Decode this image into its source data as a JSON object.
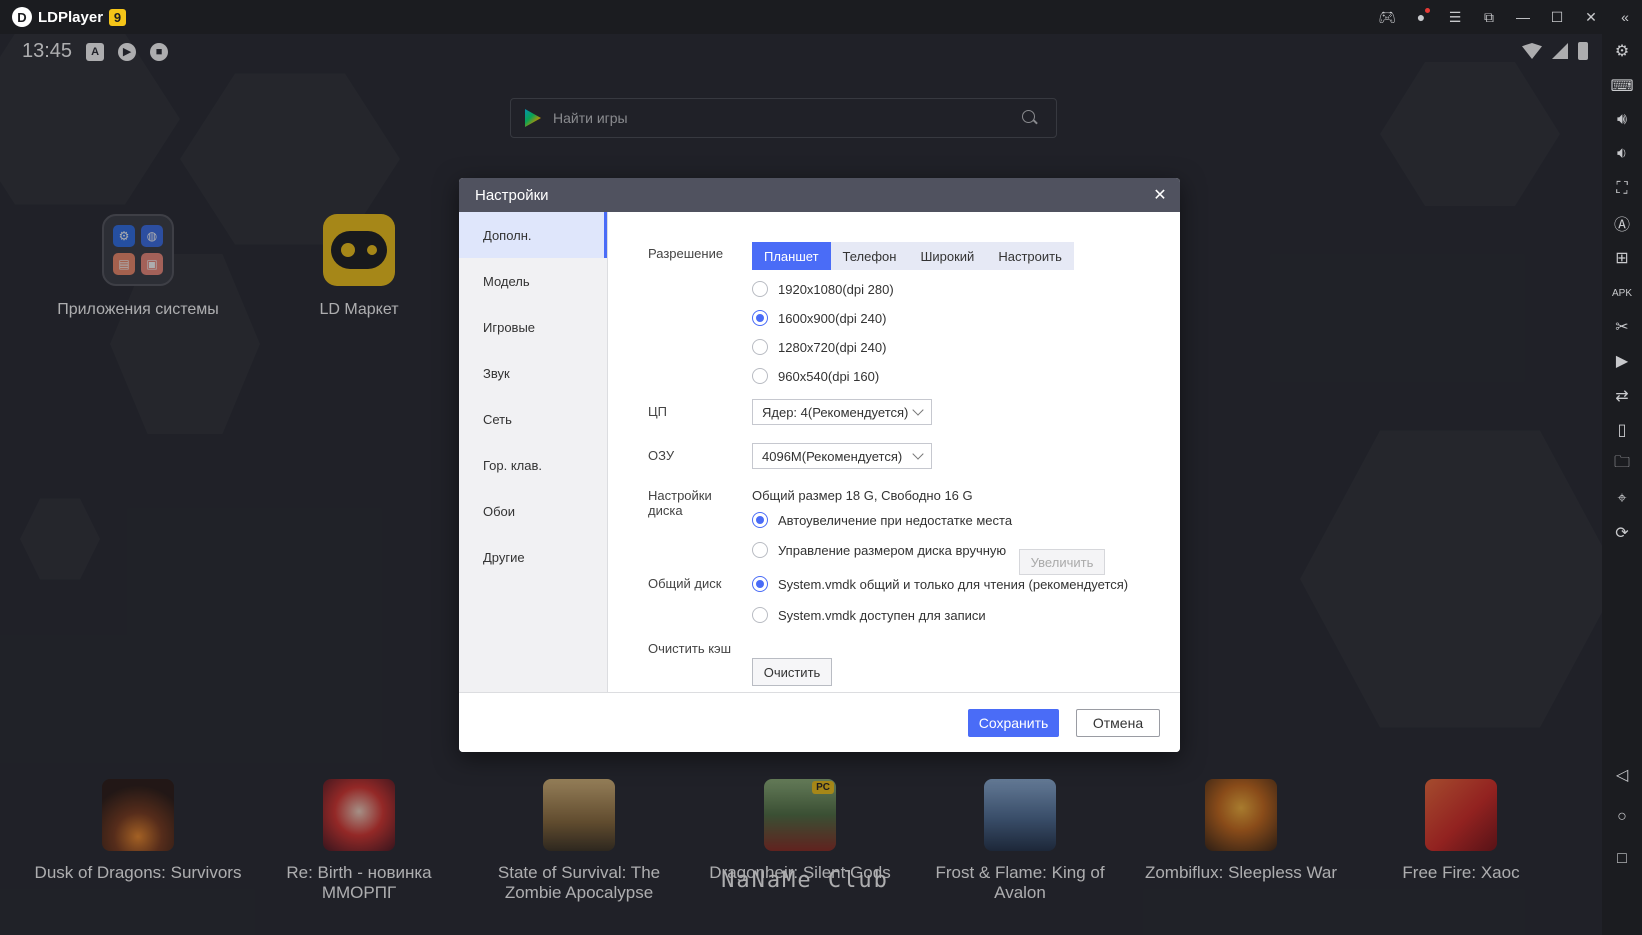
{
  "titlebar": {
    "app_name": "LDPlayer",
    "version_badge": "9",
    "icons": [
      "gamepad-icon",
      "account-icon",
      "menu-icon",
      "restore-small-icon",
      "minimize-icon",
      "maximize-icon",
      "close-icon",
      "collapse-sidebar-icon"
    ]
  },
  "status": {
    "time": "13:45",
    "left_icons": [
      "a-icon",
      "play-shield-icon",
      "shield-icon"
    ],
    "right_icons": [
      "wifi-icon",
      "signal-icon",
      "battery-icon"
    ]
  },
  "search": {
    "placeholder": "Найти игры"
  },
  "desktop_apps": [
    {
      "label": "Приложения системы"
    },
    {
      "label": "LD Маркет"
    }
  ],
  "games": [
    {
      "label": "Dusk of Dragons: Survivors"
    },
    {
      "label": "Re: Birth - новинка ММОРПГ"
    },
    {
      "label": "State of Survival: The Zombie Apocalypse"
    },
    {
      "label": "Dragonheir: Silent Gods",
      "badge": "PC"
    },
    {
      "label": "Frost & Flame: King of Avalon"
    },
    {
      "label": "Zombiflux: Sleepless War"
    },
    {
      "label": "Free Fire: Хаос"
    }
  ],
  "watermark": "NaNaMe Club",
  "sidebar_icons": [
    "settings-icon",
    "keyboard-icon",
    "volume-up-icon",
    "volume-down-icon",
    "screenshot-icon",
    "operation-record-icon",
    "add-app-icon",
    "apk-icon",
    "scissors-icon",
    "video-record-icon",
    "sync-icon",
    "shake-icon",
    "folder-icon",
    "location-icon",
    "rotate-icon",
    "back-icon",
    "home-icon",
    "recent-apps-icon"
  ],
  "dialog": {
    "title": "Настройки",
    "nav": [
      {
        "label": "Дополн.",
        "active": true
      },
      {
        "label": "Модель"
      },
      {
        "label": "Игровые"
      },
      {
        "label": "Звук"
      },
      {
        "label": "Сеть"
      },
      {
        "label": "Гор. клав."
      },
      {
        "label": "Обои"
      },
      {
        "label": "Другие"
      }
    ],
    "resolution": {
      "label": "Разрешение",
      "tabs": [
        "Планшет",
        "Телефон",
        "Широкий",
        "Настроить"
      ],
      "active_tab": "Планшет",
      "options": [
        "1920x1080(dpi 280)",
        "1600x900(dpi 240)",
        "1280x720(dpi 240)",
        "960x540(dpi 160)"
      ],
      "selected": "1600x900(dpi 240)"
    },
    "cpu": {
      "label": "ЦП",
      "value": "Ядер: 4(Рекомендуется)"
    },
    "ram": {
      "label": "ОЗУ",
      "value": "4096M(Рекомендуется)"
    },
    "disk": {
      "label": "Настройки диска",
      "summary": "Общий размер 18 G, Свободно 16 G",
      "options": [
        "Автоувеличение при недостатке места",
        "Управление размером диска вручную"
      ],
      "selected": "Автоувеличение при недостатке места",
      "increase_button": "Увеличить"
    },
    "shared_disk": {
      "label": "Общий диск",
      "options": [
        "System.vmdk общий и только для чтения (рекомендуется)",
        "System.vmdk доступен для записи"
      ],
      "selected": "System.vmdk общий и только для чтения (рекомендуется)"
    },
    "cache": {
      "label": "Очистить кэш",
      "button": "Очистить"
    },
    "save_button": "Сохранить",
    "cancel_button": "Отмена"
  },
  "colors": {
    "accent": "#4a6cf7",
    "titlebar_bg": "#1b1c20",
    "desktop_bg": "#272930",
    "dialog_header": "#50525f",
    "ld_yellow": "#f5c518"
  }
}
